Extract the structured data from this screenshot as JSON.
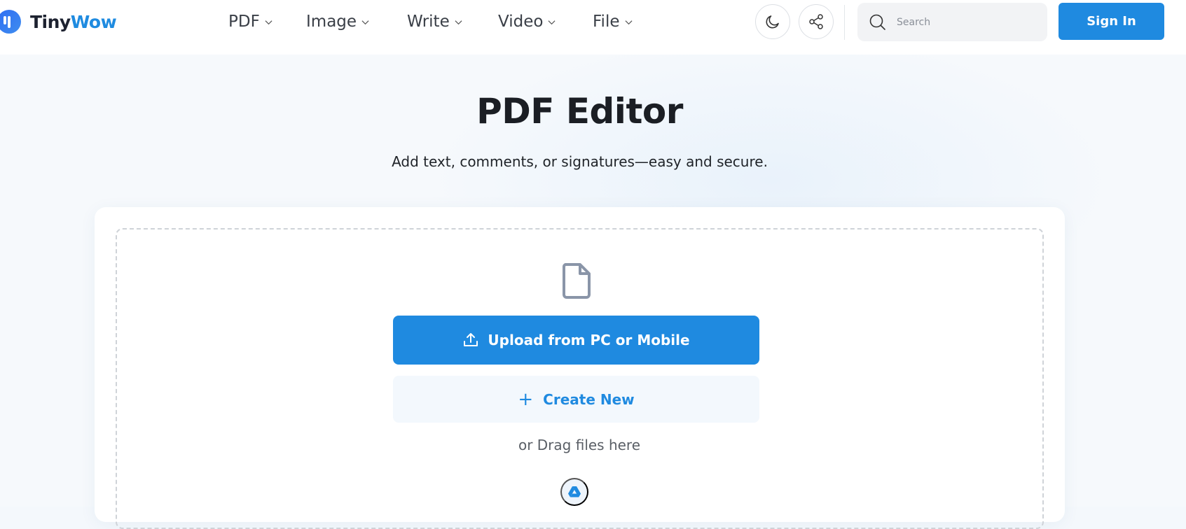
{
  "header": {
    "logo": {
      "part1": "Tiny",
      "part2": "Wow"
    },
    "nav": [
      {
        "label": "PDF"
      },
      {
        "label": "Image"
      },
      {
        "label": "Write"
      },
      {
        "label": "Video"
      },
      {
        "label": "File"
      }
    ],
    "search_placeholder": "Search",
    "sign_in_label": "Sign In"
  },
  "main": {
    "title": "PDF Editor",
    "subtitle": "Add text, comments, or signatures—easy and secure.",
    "upload_label": "Upload from PC or Mobile",
    "create_label": "Create New",
    "drag_text": "or Drag files here"
  },
  "colors": {
    "accent": "#1f8ae0",
    "logo_dark": "#1d2230",
    "background": "#f6f9fc"
  },
  "icons": [
    "chevron-down-icon",
    "moon-icon",
    "share-icon",
    "search-icon",
    "document-icon",
    "upload-icon",
    "plus-icon",
    "google-drive-icon"
  ]
}
